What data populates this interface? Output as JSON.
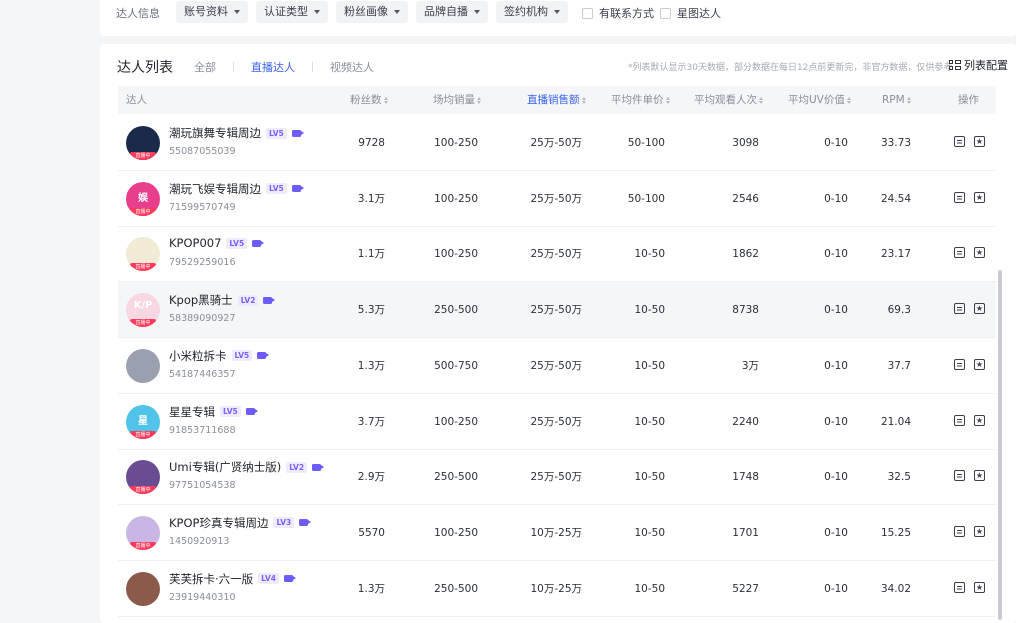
{
  "filters": {
    "label": "达人信息",
    "dropdowns": [
      "账号资料",
      "认证类型",
      "粉丝画像",
      "品牌自播",
      "签约机构"
    ],
    "checkboxes": [
      "有联系方式",
      "星图达人"
    ]
  },
  "list": {
    "title": "达人列表",
    "tabs": [
      "全部",
      "直播达人",
      "视频达人"
    ],
    "active_tab": "直播达人",
    "notice": "*列表默认显示30天数据，部分数据在每日12点前更新完，非官方数据，仅供参考",
    "column_config": "列表配置"
  },
  "columns": {
    "creator": "达人",
    "fans": "粉丝数",
    "sales": "场均销量",
    "gmv": "直播销售额",
    "unit_price": "平均件单价",
    "viewers": "平均观看人次",
    "uv": "平均UV价值",
    "rpm": "RPM",
    "ops": "操作"
  },
  "live_badge": "直播中",
  "rows": [
    {
      "name": "潮玩旗舞专辑周边",
      "level": "LV5",
      "id": "55087055039",
      "fans": "9728",
      "sales": "100-250",
      "gmv": "25万-50万",
      "unit_price": "50-100",
      "viewers": "3098",
      "uv": "0-10",
      "rpm": "33.73",
      "live": true,
      "avatar_color": "#1b2a4a"
    },
    {
      "name": "潮玩飞娱专辑周边",
      "level": "LV5",
      "id": "71599570749",
      "fans": "3.1万",
      "sales": "100-250",
      "gmv": "25万-50万",
      "unit_price": "50-100",
      "viewers": "2546",
      "uv": "0-10",
      "rpm": "24.54",
      "live": true,
      "avatar_color": "#e83e8c",
      "avatar_text": "娱"
    },
    {
      "name": "KPOP007",
      "level": "LV5",
      "id": "79529259016",
      "fans": "1.1万",
      "sales": "100-250",
      "gmv": "25万-50万",
      "unit_price": "10-50",
      "viewers": "1862",
      "uv": "0-10",
      "rpm": "23.17",
      "live": true,
      "avatar_color": "#f1ead4"
    },
    {
      "name": "Kpop黑骑士",
      "level": "LV2",
      "id": "58389090927",
      "fans": "5.3万",
      "sales": "250-500",
      "gmv": "25万-50万",
      "unit_price": "10-50",
      "viewers": "8738",
      "uv": "0-10",
      "rpm": "69.3",
      "live": true,
      "avatar_color": "#f7d7e2",
      "avatar_text": "K/P"
    },
    {
      "name": "小米粒拆卡",
      "level": "LV5",
      "id": "54187446357",
      "fans": "1.3万",
      "sales": "500-750",
      "gmv": "25万-50万",
      "unit_price": "10-50",
      "viewers": "3万",
      "uv": "0-10",
      "rpm": "37.7",
      "live": false,
      "avatar_color": "#9aa0b0"
    },
    {
      "name": "星星专辑",
      "level": "LV5",
      "id": "91853711688",
      "fans": "3.7万",
      "sales": "100-250",
      "gmv": "25万-50万",
      "unit_price": "10-50",
      "viewers": "2240",
      "uv": "0-10",
      "rpm": "21.04",
      "live": true,
      "avatar_color": "#4fc3e8",
      "avatar_text": "星"
    },
    {
      "name": "Umi专辑(广贤纳士版)",
      "level": "LV2",
      "id": "97751054538",
      "fans": "2.9万",
      "sales": "250-500",
      "gmv": "25万-50万",
      "unit_price": "10-50",
      "viewers": "1748",
      "uv": "0-10",
      "rpm": "32.5",
      "live": true,
      "avatar_color": "#6a4c93"
    },
    {
      "name": "KPOP珍真专辑周边",
      "level": "LV3",
      "id": "1450920913",
      "fans": "5570",
      "sales": "100-250",
      "gmv": "10万-25万",
      "unit_price": "10-50",
      "viewers": "1701",
      "uv": "0-10",
      "rpm": "15.25",
      "live": true,
      "avatar_color": "#c9b6e4"
    },
    {
      "name": "芙芙拆卡·六一版",
      "level": "LV4",
      "id": "23919440310",
      "fans": "1.3万",
      "sales": "250-500",
      "gmv": "10万-25万",
      "unit_price": "10-50",
      "viewers": "5227",
      "uv": "0-10",
      "rpm": "34.02",
      "live": false,
      "avatar_color": "#8b5a4a"
    }
  ],
  "icons": {
    "detail": "detail-icon",
    "favorite": "favorite-icon",
    "camera": "live-camera-icon",
    "column_config": "grid-icon"
  }
}
